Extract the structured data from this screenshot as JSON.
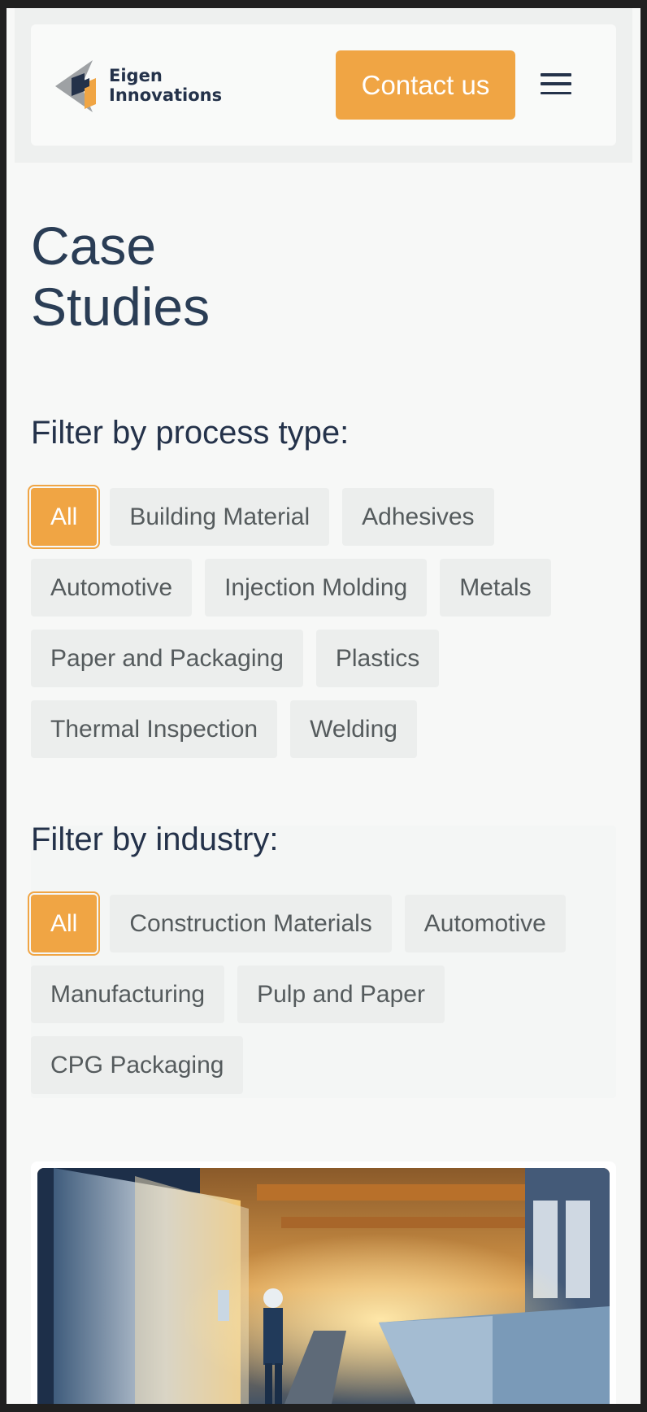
{
  "header": {
    "logo": {
      "line1": "Eigen",
      "line2": "Innovations"
    },
    "contact_label": "Contact us",
    "menu_icon": "hamburger-menu-icon"
  },
  "page": {
    "title_line1": "Case",
    "title_line2": "Studies"
  },
  "process_filter": {
    "heading": "Filter by process type:",
    "options": [
      "All",
      "Building Material",
      "Adhesives",
      "Automotive",
      "Injection Molding",
      "Metals",
      "Paper and Packaging",
      "Plastics",
      "Thermal Inspection",
      "Welding"
    ],
    "selected": "All"
  },
  "industry_filter": {
    "heading": "Filter by industry:",
    "options": [
      "All",
      "Construction Materials",
      "Automotive",
      "Manufacturing",
      "Pulp and Paper",
      "CPG Packaging"
    ],
    "selected": "All"
  },
  "colors": {
    "accent": "#f0a544",
    "heading": "#24324a",
    "chip_bg": "#eceeed"
  }
}
